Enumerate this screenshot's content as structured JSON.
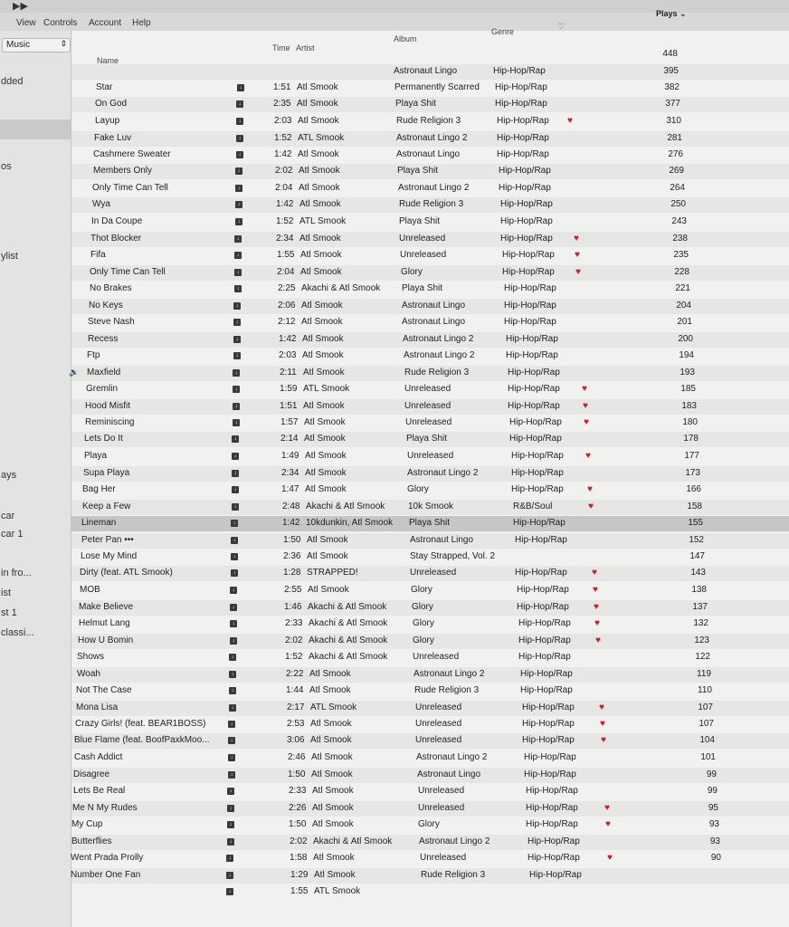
{
  "menubar": {
    "view": "View",
    "controls": "Controls",
    "account": "Account",
    "help": "Help"
  },
  "sidebar": {
    "library_select": "Music",
    "items": [
      "dded",
      "os",
      "ylist",
      "ays",
      "car",
      "car 1",
      "in fro...",
      "ist",
      "st 1",
      "classi..."
    ]
  },
  "header": {
    "name": "Name",
    "time": "Time",
    "artist": "Artist",
    "album": "Album",
    "genre": "Genre",
    "plays": "Plays ⌄"
  },
  "songs": [
    {
      "name": "",
      "time": "",
      "artist": "",
      "album": "",
      "genre": "",
      "loved": false,
      "plays": "448"
    },
    {
      "name": "",
      "time": "",
      "artist": "",
      "album": "Astronaut Lingo",
      "genre": "Hip-Hop/Rap",
      "loved": false,
      "plays": "395"
    },
    {
      "name": "Star",
      "time": "1:51",
      "artist": "Atl Smook",
      "album": "Permanently Scarred",
      "genre": "Hip-Hop/Rap",
      "loved": false,
      "plays": "382"
    },
    {
      "name": "On God",
      "time": "2:35",
      "artist": "Atl Smook",
      "album": "Playa Shit",
      "genre": "Hip-Hop/Rap",
      "loved": false,
      "plays": "377"
    },
    {
      "name": "Layup",
      "time": "2:03",
      "artist": "Atl Smook",
      "album": "Rude Religion 3",
      "genre": "Hip-Hop/Rap",
      "loved": true,
      "plays": "310"
    },
    {
      "name": "Fake Luv",
      "time": "1:52",
      "artist": "ATL Smook",
      "album": "Astronaut Lingo 2",
      "genre": "Hip-Hop/Rap",
      "loved": false,
      "plays": "281"
    },
    {
      "name": "Cashmere Sweater",
      "time": "1:42",
      "artist": "Atl Smook",
      "album": "Astronaut Lingo",
      "genre": "Hip-Hop/Rap",
      "loved": false,
      "plays": "276"
    },
    {
      "name": "Members Only",
      "time": "2:02",
      "artist": "Atl Smook",
      "album": "Playa Shit",
      "genre": "Hip-Hop/Rap",
      "loved": false,
      "plays": "269"
    },
    {
      "name": "Only Time Can Tell",
      "time": "2:04",
      "artist": "Atl Smook",
      "album": "Astronaut Lingo 2",
      "genre": "Hip-Hop/Rap",
      "loved": false,
      "plays": "264"
    },
    {
      "name": "Wya",
      "time": "1:42",
      "artist": "Atl Smook",
      "album": "Rude Religion 3",
      "genre": "Hip-Hop/Rap",
      "loved": false,
      "plays": "250"
    },
    {
      "name": "In Da Coupe",
      "time": "1:52",
      "artist": "ATL Smook",
      "album": "Playa Shit",
      "genre": "Hip-Hop/Rap",
      "loved": false,
      "plays": "243"
    },
    {
      "name": "Thot Blocker",
      "time": "2:34",
      "artist": "Atl Smook",
      "album": "Unreleased",
      "genre": "Hip-Hop/Rap",
      "loved": true,
      "plays": "238"
    },
    {
      "name": "Fifa",
      "time": "1:55",
      "artist": "Atl Smook",
      "album": "Unreleased",
      "genre": "Hip-Hop/Rap",
      "loved": true,
      "plays": "235"
    },
    {
      "name": "Only Time Can Tell",
      "time": "2:04",
      "artist": "Atl Smook",
      "album": "Glory",
      "genre": "Hip-Hop/Rap",
      "loved": true,
      "plays": "228"
    },
    {
      "name": "No Brakes",
      "time": "2:25",
      "artist": "Akachi & Atl Smook",
      "album": "Playa Shit",
      "genre": "Hip-Hop/Rap",
      "loved": false,
      "plays": "221"
    },
    {
      "name": "No Keys",
      "time": "2:06",
      "artist": "Atl Smook",
      "album": "Astronaut Lingo",
      "genre": "Hip-Hop/Rap",
      "loved": false,
      "plays": "204"
    },
    {
      "name": "Steve Nash",
      "time": "2:12",
      "artist": "Atl Smook",
      "album": "Astronaut Lingo",
      "genre": "Hip-Hop/Rap",
      "loved": false,
      "plays": "201"
    },
    {
      "name": "Recess",
      "time": "1:42",
      "artist": "Atl Smook",
      "album": "Astronaut Lingo 2",
      "genre": "Hip-Hop/Rap",
      "loved": false,
      "plays": "200"
    },
    {
      "name": "Ftp",
      "time": "2:03",
      "artist": "Atl Smook",
      "album": "Astronaut Lingo 2",
      "genre": "Hip-Hop/Rap",
      "loved": false,
      "plays": "194"
    },
    {
      "name": "Maxfield",
      "time": "2:11",
      "artist": "Atl Smook",
      "album": "Rude Religion 3",
      "genre": "Hip-Hop/Rap",
      "loved": false,
      "plays": "193",
      "playing": true
    },
    {
      "name": "Gremlin",
      "time": "1:59",
      "artist": "ATL Smook",
      "album": "Unreleased",
      "genre": "Hip-Hop/Rap",
      "loved": true,
      "plays": "185"
    },
    {
      "name": "Hood Misfit",
      "time": "1:51",
      "artist": "Atl Smook",
      "album": "Unreleased",
      "genre": "Hip-Hop/Rap",
      "loved": true,
      "plays": "183"
    },
    {
      "name": "Reminiscing",
      "time": "1:57",
      "artist": "Atl Smook",
      "album": "Unreleased",
      "genre": "Hip-Hop/Rap",
      "loved": true,
      "plays": "180"
    },
    {
      "name": "Lets Do It",
      "time": "2:14",
      "artist": "Atl Smook",
      "album": "Playa Shit",
      "genre": "Hip-Hop/Rap",
      "loved": false,
      "plays": "178"
    },
    {
      "name": "Playa",
      "time": "1:49",
      "artist": "Atl Smook",
      "album": "Unreleased",
      "genre": "Hip-Hop/Rap",
      "loved": true,
      "plays": "177"
    },
    {
      "name": "Supa Playa",
      "time": "2:34",
      "artist": "Atl Smook",
      "album": "Astronaut Lingo 2",
      "genre": "Hip-Hop/Rap",
      "loved": false,
      "plays": "173"
    },
    {
      "name": "Bag Her",
      "time": "1:47",
      "artist": "Atl Smook",
      "album": "Glory",
      "genre": "Hip-Hop/Rap",
      "loved": true,
      "plays": "166"
    },
    {
      "name": "Keep a Few",
      "time": "2:48",
      "artist": "Akachi & Atl Smook",
      "album": "10k Smook",
      "genre": "R&B/Soul",
      "loved": true,
      "plays": "158"
    },
    {
      "name": "Lineman",
      "time": "1:42",
      "artist": "10kdunkin, Atl Smook",
      "album": "Playa Shit",
      "genre": "Hip-Hop/Rap",
      "loved": false,
      "plays": "155",
      "selected": true
    },
    {
      "name": "Peter Pan •••",
      "time": "1:50",
      "artist": "Atl Smook",
      "album": "Astronaut Lingo",
      "genre": "Hip-Hop/Rap",
      "loved": false,
      "plays": "152"
    },
    {
      "name": "Lose My Mind",
      "time": "2:36",
      "artist": "Atl Smook",
      "album": "Stay Strapped, Vol. 2",
      "genre": "",
      "loved": false,
      "plays": "147"
    },
    {
      "name": "Dirty (feat. ATL Smook)",
      "time": "1:28",
      "artist": "STRAPPED!",
      "album": "Unreleased",
      "genre": "Hip-Hop/Rap",
      "loved": true,
      "plays": "143"
    },
    {
      "name": "MOB",
      "time": "2:55",
      "artist": "Atl Smook",
      "album": "Glory",
      "genre": "Hip-Hop/Rap",
      "loved": true,
      "plays": "138"
    },
    {
      "name": "Make Believe",
      "time": "1:46",
      "artist": "Akachi & Atl Smook",
      "album": "Glory",
      "genre": "Hip-Hop/Rap",
      "loved": true,
      "plays": "137"
    },
    {
      "name": "Helmut Lang",
      "time": "2:33",
      "artist": "Akachi & Atl Smook",
      "album": "Glory",
      "genre": "Hip-Hop/Rap",
      "loved": true,
      "plays": "132"
    },
    {
      "name": "How U Bomin",
      "time": "2:02",
      "artist": "Akachi & Atl Smook",
      "album": "Glory",
      "genre": "Hip-Hop/Rap",
      "loved": true,
      "plays": "123"
    },
    {
      "name": "Shows",
      "time": "1:52",
      "artist": "Akachi & Atl Smook",
      "album": "Unreleased",
      "genre": "Hip-Hop/Rap",
      "loved": false,
      "plays": "122"
    },
    {
      "name": "Woah",
      "time": "2:22",
      "artist": "Atl Smook",
      "album": "Astronaut Lingo 2",
      "genre": "Hip-Hop/Rap",
      "loved": false,
      "plays": "119"
    },
    {
      "name": "Not The Case",
      "time": "1:44",
      "artist": "Atl Smook",
      "album": "Rude Religion 3",
      "genre": "Hip-Hop/Rap",
      "loved": false,
      "plays": "110"
    },
    {
      "name": "Mona Lisa",
      "time": "2:17",
      "artist": "ATL Smook",
      "album": "Unreleased",
      "genre": "Hip-Hop/Rap",
      "loved": true,
      "plays": "107"
    },
    {
      "name": "Crazy Girls! (feat. BEAR1BOSS)",
      "time": "2:53",
      "artist": "Atl Smook",
      "album": "Unreleased",
      "genre": "Hip-Hop/Rap",
      "loved": true,
      "plays": "107"
    },
    {
      "name": "Blue Flame (feat. BoofPaxkMoo...",
      "time": "3:06",
      "artist": "Atl Smook",
      "album": "Unreleased",
      "genre": "Hip-Hop/Rap",
      "loved": true,
      "plays": "104"
    },
    {
      "name": "Cash Addict",
      "time": "2:46",
      "artist": "Atl Smook",
      "album": "Astronaut Lingo 2",
      "genre": "Hip-Hop/Rap",
      "loved": false,
      "plays": "101"
    },
    {
      "name": "Disagree",
      "time": "1:50",
      "artist": "Atl Smook",
      "album": "Astronaut Lingo",
      "genre": "Hip-Hop/Rap",
      "loved": false,
      "plays": "99"
    },
    {
      "name": "Lets Be Real",
      "time": "2:33",
      "artist": "Atl Smook",
      "album": "Unreleased",
      "genre": "Hip-Hop/Rap",
      "loved": false,
      "plays": "99"
    },
    {
      "name": "Me N My Rudes",
      "time": "2:26",
      "artist": "Atl Smook",
      "album": "Unreleased",
      "genre": "Hip-Hop/Rap",
      "loved": true,
      "plays": "95"
    },
    {
      "name": "My Cup",
      "time": "1:50",
      "artist": "Atl Smook",
      "album": "Glory",
      "genre": "Hip-Hop/Rap",
      "loved": true,
      "plays": "93"
    },
    {
      "name": "Butterflies",
      "time": "2:02",
      "artist": "Akachi & Atl Smook",
      "album": "Astronaut Lingo 2",
      "genre": "Hip-Hop/Rap",
      "loved": false,
      "plays": "93"
    },
    {
      "name": "Went Prada Prolly",
      "time": "1:58",
      "artist": "Atl Smook",
      "album": "Unreleased",
      "genre": "Hip-Hop/Rap",
      "loved": true,
      "plays": "90"
    },
    {
      "name": "Number One Fan",
      "time": "1:29",
      "artist": "Atl Smook",
      "album": "Rude Religion 3",
      "genre": "Hip-Hop/Rap",
      "loved": false,
      "plays": ""
    },
    {
      "name": "",
      "time": "1:55",
      "artist": "ATL Smook",
      "album": "",
      "genre": "",
      "loved": false,
      "plays": ""
    }
  ],
  "colors": {
    "heart": "#d0182b",
    "speaker": "#2b6fd6",
    "row_alt": "#e6e6e4",
    "row_selected": "#c6c6c4"
  },
  "icons": {
    "play": "fast-forward-icon",
    "cloud": "cloud-status-icon",
    "loved": "heart-icon",
    "now_playing": "speaker-icon",
    "select": "chevron-updown-icon"
  }
}
